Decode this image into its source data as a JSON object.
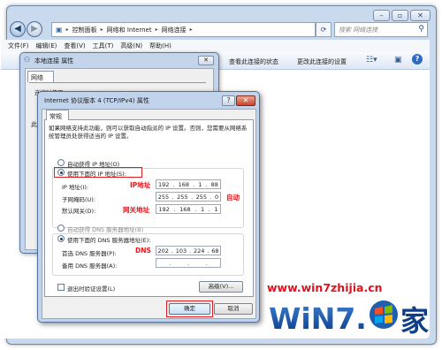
{
  "explorer": {
    "breadcrumb": [
      "控制面板",
      "网络和 Internet",
      "网络连接"
    ],
    "search_placeholder": "搜索 网络连接",
    "menu": [
      "文件(F)",
      "编辑(E)",
      "查看(V)",
      "工具(T)",
      "高级(N)",
      "帮助(H)"
    ],
    "commands": [
      "查看此连接的状态",
      "更改此连接的设置"
    ],
    "caption_buttons": [
      "minimize",
      "maximize",
      "close"
    ]
  },
  "local_props": {
    "title": "本地连接 属性",
    "tab": "网络",
    "partial_label": "连接时使用:",
    "partial_letter": "此"
  },
  "ipv4": {
    "title": "Internet 协议版本 4 (TCP/IPv4) 属性",
    "tab": "常规",
    "description": "如果网络支持此功能，则可以获取自动指派的 IP 设置。否则，您需要从网络系统管理员处获得适当的 IP 设置。",
    "auto_ip_label": "自动获得 IP 地址(O)",
    "manual_ip_label": "使用下面的 IP 地址(S):",
    "ip_label": "IP 地址(I):",
    "mask_label": "子网掩码(U):",
    "gateway_label": "默认网关(D):",
    "ip": [
      "192",
      "168",
      "1",
      "88"
    ],
    "mask": [
      "255",
      "255",
      "255",
      "0"
    ],
    "gateway": [
      "192",
      "168",
      "1",
      "1"
    ],
    "auto_dns_label": "自动获得 DNS 服务器地址(B)",
    "manual_dns_label": "使用下面的 DNS 服务器地址(E):",
    "dns1_label": "首选 DNS 服务器(P):",
    "dns2_label": "备用 DNS 服务器(A):",
    "dns1": [
      "202",
      "103",
      "224",
      "68"
    ],
    "dns2": [
      "",
      "",
      "",
      ""
    ],
    "validate_label": "退出时验证设置(L)",
    "advanced_button": "高级(V)...",
    "ok_button": "确定",
    "cancel_button": "取消",
    "selected_ip_mode": "manual",
    "selected_dns_mode": "manual"
  },
  "annotations": {
    "ip": "IP地址",
    "auto": "自动",
    "gateway": "网关地址",
    "dns": "DNS",
    "color": "#e8151b"
  },
  "watermark": {
    "url": "www.win7zhijia.cn",
    "logo_text": "WiN7.",
    "logo_suffix": "家"
  }
}
